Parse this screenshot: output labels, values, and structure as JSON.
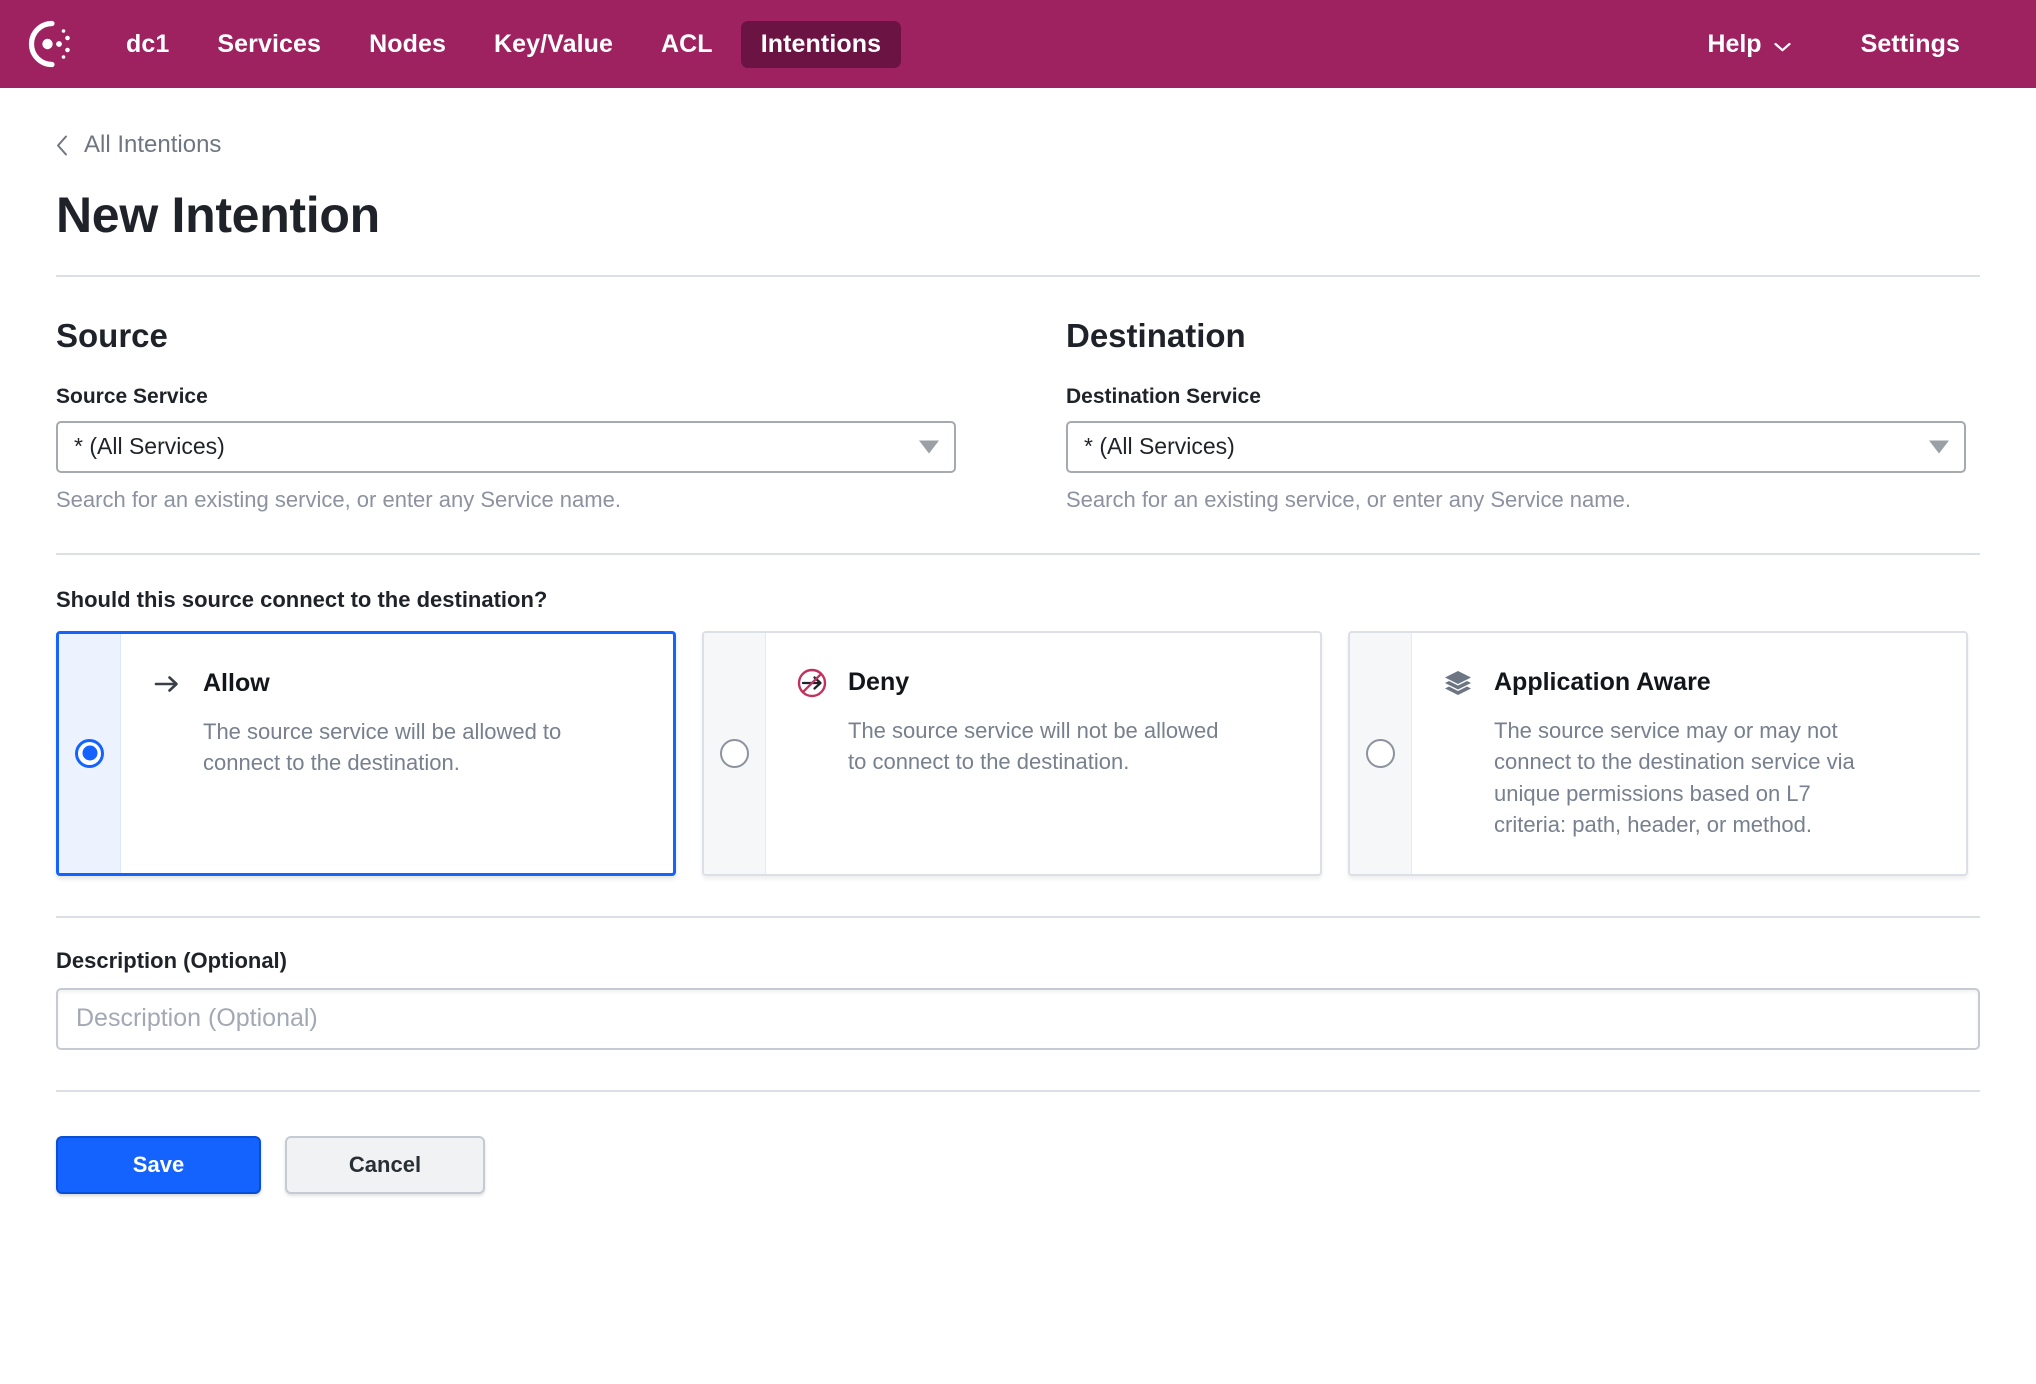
{
  "nav": {
    "logo_icon": "consul-logo-icon",
    "items": [
      {
        "label": "dc1",
        "active": false
      },
      {
        "label": "Services",
        "active": false
      },
      {
        "label": "Nodes",
        "active": false
      },
      {
        "label": "Key/Value",
        "active": false
      },
      {
        "label": "ACL",
        "active": false
      },
      {
        "label": "Intentions",
        "active": true
      }
    ],
    "help_label": "Help",
    "help_caret_icon": "chevron-down-icon",
    "settings_label": "Settings",
    "background_color": "#9E2160",
    "active_item_color": "#6B1342"
  },
  "breadcrumb": {
    "back_icon": "chevron-left-icon",
    "label": "All Intentions"
  },
  "page": {
    "title": "New Intention"
  },
  "source": {
    "section_title": "Source",
    "field_label": "Source Service",
    "value": "* (All Services)",
    "caret_icon": "triangle-down-icon",
    "help_text": "Search for an existing service, or enter any Service name."
  },
  "destination": {
    "section_title": "Destination",
    "field_label": "Destination Service",
    "value": "* (All Services)",
    "caret_icon": "triangle-down-icon",
    "help_text": "Search for an existing service, or enter any Service name."
  },
  "permission": {
    "question": "Should this source connect to the destination?",
    "options": [
      {
        "id": "allow",
        "title": "Allow",
        "icon": "arrow-right-icon",
        "description": "The source service will be allowed to connect to the destination.",
        "selected": true
      },
      {
        "id": "deny",
        "title": "Deny",
        "icon": "no-entry-arrow-icon",
        "description": "The source service will not be allowed to connect to the destination.",
        "selected": false
      },
      {
        "id": "app-aware",
        "title": "Application Aware",
        "icon": "layers-icon",
        "description": "The source service may or may not connect to the destination service via unique permissions based on L7 criteria: path, header, or method.",
        "selected": false
      }
    ]
  },
  "description": {
    "label": "Description (Optional)",
    "value": "",
    "placeholder": "Description (Optional)"
  },
  "actions": {
    "save_label": "Save",
    "cancel_label": "Cancel",
    "primary_color": "#1563FF"
  }
}
